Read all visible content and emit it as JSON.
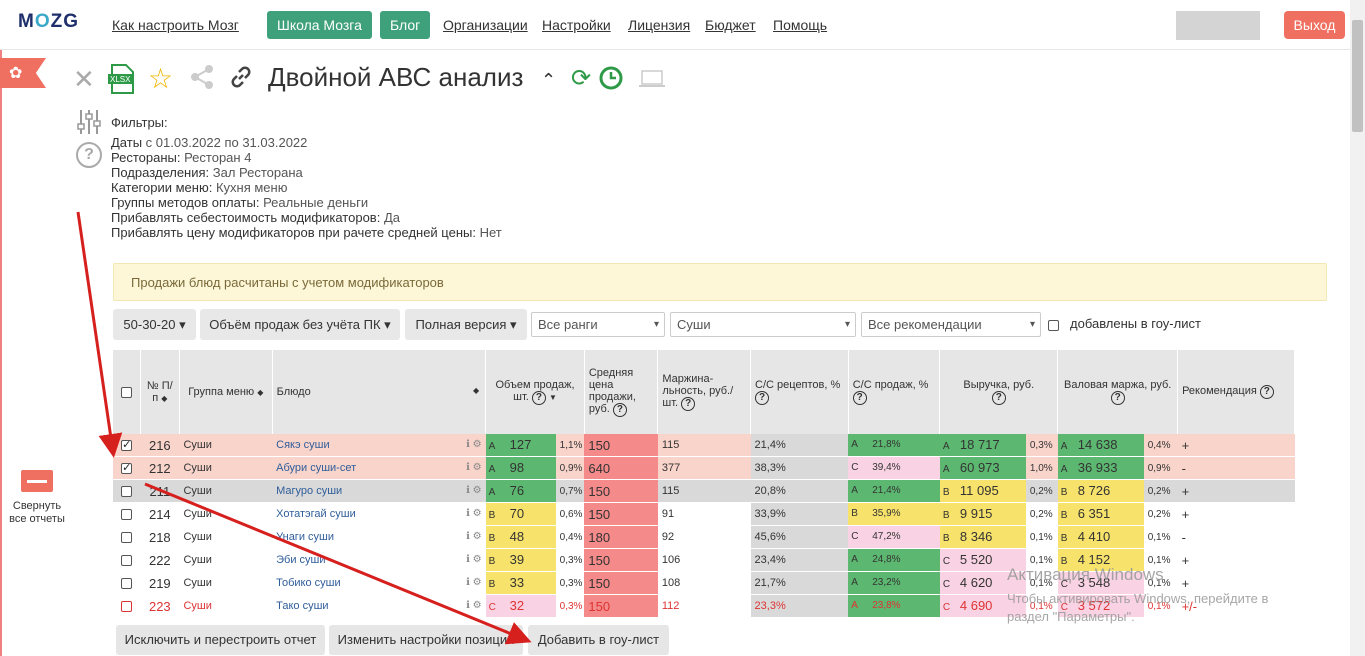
{
  "header": {
    "logo": "MOZG",
    "nav": [
      "Как настроить Мозг",
      "Организации",
      "Настройки",
      "Лицензия",
      "Бюджет",
      "Помощь"
    ],
    "btn_school": "Школа Мозга",
    "btn_blog": "Блог",
    "logout": "Выход"
  },
  "sidebar": {
    "collapse_line1": "Свернуть",
    "collapse_line2": "все отчеты"
  },
  "report": {
    "title": "Двойной АВС анализ"
  },
  "filters": {
    "heading": "Фильтры:",
    "rows": [
      {
        "k": "Даты",
        "v": " с 01.03.2022 по 31.03.2022"
      },
      {
        "k": "Рестораны:",
        "v": " Ресторан 4"
      },
      {
        "k": "Подразделения:",
        "v": " Зал Ресторана"
      },
      {
        "k": "Категории меню:",
        "v": " Кухня меню"
      },
      {
        "k": "Группы методов оплаты:",
        "v": " Реальные деньги"
      },
      {
        "k": "Прибавлять себестоимость модификаторов:",
        "v": " Да"
      },
      {
        "k": "Прибавлять цену модификаторов при рачете средней цены:",
        "v": " Нет"
      }
    ]
  },
  "note": "Продажи блюд расчитаны с учетом модификаторов",
  "toolbar": {
    "b1": "50-30-20",
    "b2": "Объём продаж без учёта ПК",
    "b3": "Полная версия",
    "s1": "Все ранги",
    "s2": "Суши",
    "s3": "Все рекомендации",
    "chk": "добавлены в гоу-лист"
  },
  "columns": {
    "num": "№ П/п",
    "group": "Группа меню",
    "dish": "Блюдо",
    "vol": "Объем продаж, шт.",
    "price": "Средняя цена продажи, руб.",
    "margin": "Маржина- льность, руб./шт.",
    "ccr": "С/С рецептов, %",
    "ccs": "С/С продаж, %",
    "rev": "Выручка, руб.",
    "gm": "Валовая маржа, руб.",
    "rec": "Рекомендация"
  },
  "rows": [
    {
      "chk": true,
      "n": "216",
      "g": "Суши",
      "d": "Сякэ суши",
      "vr": "A",
      "v": "127",
      "vp": "1,1%",
      "p": "150",
      "m": "115",
      "cr": "21,4%",
      "sr": "A",
      "s": "21,8%",
      "rr": "A",
      "r": "18 717",
      "rp": "0,3%",
      "gr": "A",
      "gm": "14 638",
      "gp": "0,4%",
      "rec": "+"
    },
    {
      "chk": true,
      "n": "212",
      "g": "Суши",
      "d": "Абури суши-сет",
      "vr": "A",
      "v": "98",
      "vp": "0,9%",
      "p": "640",
      "m": "377",
      "cr": "38,3%",
      "sr": "C",
      "s": "39,4%",
      "rr": "A",
      "r": "60 973",
      "rp": "1,0%",
      "gr": "A",
      "gm": "36 933",
      "gp": "0,9%",
      "rec": "-"
    },
    {
      "chk": false,
      "n": "211",
      "g": "Суши",
      "d": "Магуро суши",
      "vr": "A",
      "v": "76",
      "vp": "0,7%",
      "p": "150",
      "m": "115",
      "cr": "20,8%",
      "sr": "A",
      "s": "21,4%",
      "rr": "B",
      "r": "11 095",
      "rp": "0,2%",
      "gr": "B",
      "gm": "8 726",
      "gp": "0,2%",
      "rec": "+"
    },
    {
      "chk": false,
      "n": "214",
      "g": "Суши",
      "d": "Хотатэгай суши",
      "vr": "B",
      "v": "70",
      "vp": "0,6%",
      "p": "150",
      "m": "91",
      "cr": "33,9%",
      "sr": "B",
      "s": "35,9%",
      "rr": "B",
      "r": "9 915",
      "rp": "0,2%",
      "gr": "B",
      "gm": "6 351",
      "gp": "0,2%",
      "rec": "+"
    },
    {
      "chk": false,
      "n": "218",
      "g": "Суши",
      "d": "Унаги суши",
      "vr": "B",
      "v": "48",
      "vp": "0,4%",
      "p": "180",
      "m": "92",
      "cr": "45,6%",
      "sr": "C",
      "s": "47,2%",
      "rr": "B",
      "r": "8 346",
      "rp": "0,1%",
      "gr": "B",
      "gm": "4 410",
      "gp": "0,1%",
      "rec": "-"
    },
    {
      "chk": false,
      "n": "222",
      "g": "Суши",
      "d": "Эби суши",
      "vr": "B",
      "v": "39",
      "vp": "0,3%",
      "p": "150",
      "m": "106",
      "cr": "23,4%",
      "sr": "A",
      "s": "24,8%",
      "rr": "C",
      "r": "5 520",
      "rp": "0,1%",
      "gr": "B",
      "gm": "4 152",
      "gp": "0,1%",
      "rec": "+"
    },
    {
      "chk": false,
      "n": "219",
      "g": "Суши",
      "d": "Тобико суши",
      "vr": "B",
      "v": "33",
      "vp": "0,3%",
      "p": "150",
      "m": "108",
      "cr": "21,7%",
      "sr": "A",
      "s": "23,2%",
      "rr": "C",
      "r": "4 620",
      "rp": "0,1%",
      "gr": "C",
      "gm": "3 548",
      "gp": "0,1%",
      "rec": "+"
    },
    {
      "chk": false,
      "red": true,
      "n": "223",
      "g": "Суши",
      "d": "Тако суши",
      "vr": "C",
      "v": "32",
      "vp": "0,3%",
      "p": "150",
      "m": "112",
      "cr": "23,3%",
      "sr": "A",
      "s": "23,8%",
      "rr": "C",
      "r": "4 690",
      "rp": "0,1%",
      "gr": "C",
      "gm": "3 572",
      "gp": "0,1%",
      "rec": "+/-"
    }
  ],
  "bottom": {
    "b1": "Исключить и перестроить отчет",
    "b2": "Изменить настройки позиций",
    "b3": "Добавить в гоу-лист"
  },
  "watermark": {
    "line1": "Активация Windows",
    "line2": "Чтобы активировать Windows, перейдите в",
    "line3": "раздел \"Параметры\"."
  },
  "colors": {
    "green": "#5cb870",
    "yellow": "#f7e36b",
    "pink": "#f9d3e3",
    "red": "#f48a8a",
    "rowsel": "#f9d4cb",
    "gray": "#d9d9d9"
  }
}
